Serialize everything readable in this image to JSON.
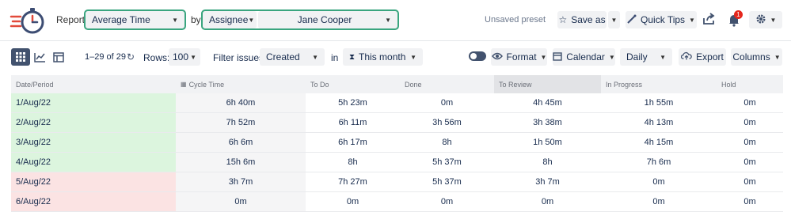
{
  "header": {
    "report_label": "Report:",
    "report_value": "Average Time",
    "by_label": "by",
    "groupby_value": "Assignee",
    "assignee_value": "Jane Cooper",
    "unsaved_label": "Unsaved preset",
    "saveas_label": "Save as",
    "quicktips_label": "Quick Tips",
    "notification_count": "1"
  },
  "toolbar": {
    "range_label": "1–29 of 29",
    "rows_label": "Rows:",
    "rows_value": "100",
    "filter_label": "Filter issues:",
    "filter_value": "Created",
    "in_label": "in",
    "period_value": "This month",
    "format_label": "Format",
    "calendar_label": "Calendar",
    "granularity_value": "Daily",
    "export_label": "Export",
    "columns_label": "Columns"
  },
  "table": {
    "headers": [
      "Date/Period",
      "Cycle Time",
      "To Do",
      "Done",
      "To Review",
      "In Progress",
      "Hold"
    ],
    "rows": [
      {
        "status": "green",
        "cells": [
          "1/Aug/22",
          "6h 40m",
          "5h 23m",
          "0m",
          "4h 45m",
          "1h 55m",
          "0m"
        ]
      },
      {
        "status": "green",
        "cells": [
          "2/Aug/22",
          "7h 52m",
          "6h 11m",
          "3h 56m",
          "3h 38m",
          "4h 13m",
          "0m"
        ]
      },
      {
        "status": "green",
        "cells": [
          "3/Aug/22",
          "6h 6m",
          "6h 17m",
          "8h",
          "1h 50m",
          "4h 15m",
          "0m"
        ]
      },
      {
        "status": "green",
        "cells": [
          "4/Aug/22",
          "15h 6m",
          "8h",
          "5h 37m",
          "8h",
          "7h 6m",
          "0m"
        ]
      },
      {
        "status": "red",
        "cells": [
          "5/Aug/22",
          "3h 7m",
          "7h 27m",
          "5h 37m",
          "3h 7m",
          "0m",
          "0m"
        ]
      },
      {
        "status": "red",
        "cells": [
          "6/Aug/22",
          "0m",
          "0m",
          "0m",
          "0m",
          "0m",
          "0m"
        ]
      }
    ]
  },
  "colors": {
    "accent_outline": "#3aa57f",
    "row_green": "#dcf5de",
    "row_red": "#fbe3e3",
    "notification_red": "#e5271d",
    "header_bg": "#f1f2f4"
  }
}
